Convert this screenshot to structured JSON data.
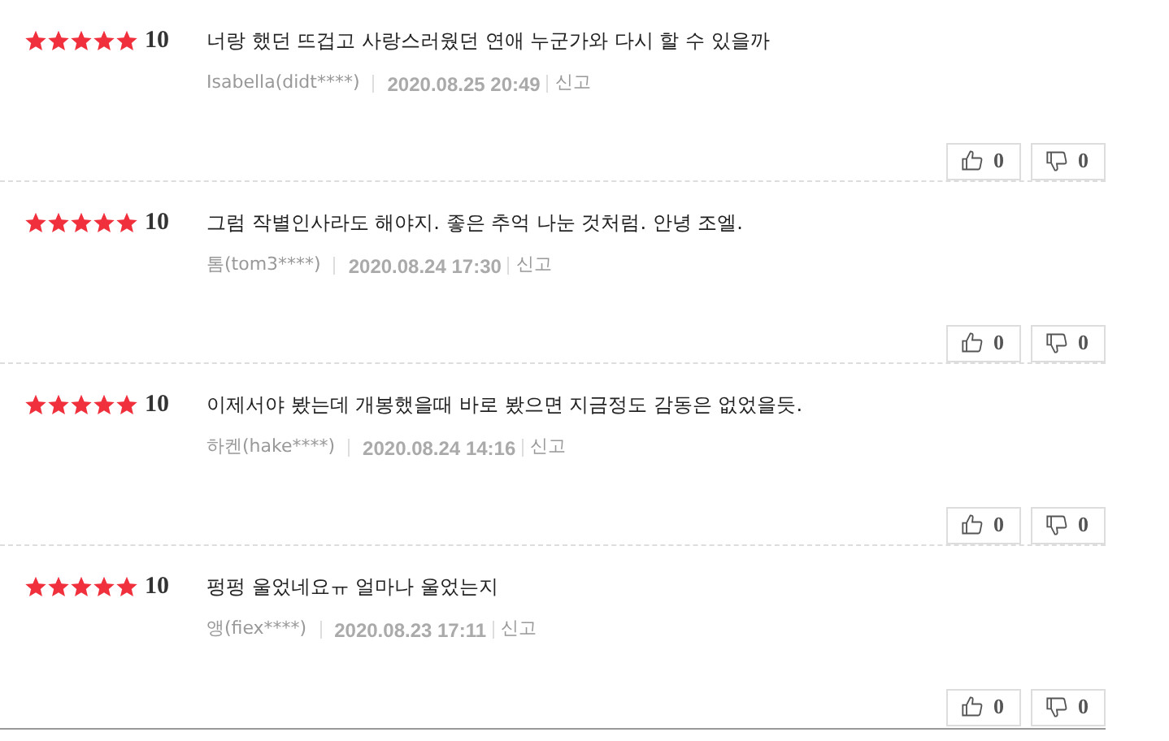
{
  "reviews": [
    {
      "stars": 5,
      "score": "10",
      "text": "너랑 했던 뜨겁고 사랑스러웠던 연애 누군가와 다시 할 수 있을까",
      "author": "Isabella(didt****)",
      "date": "2020.08.25 20:49",
      "report": "신고",
      "likes": "0",
      "dislikes": "0"
    },
    {
      "stars": 5,
      "score": "10",
      "text": "그럼 작별인사라도 해야지. 좋은 추억 나눈 것처럼. 안녕 조엘.",
      "author": "톰(tom3****)",
      "date": "2020.08.24 17:30",
      "report": "신고",
      "likes": "0",
      "dislikes": "0"
    },
    {
      "stars": 5,
      "score": "10",
      "text": "이제서야 봤는데 개봉했을때 바로 봤으면 지금정도 감동은 없었을듯.",
      "author": "하켄(hake****)",
      "date": "2020.08.24 14:16",
      "report": "신고",
      "likes": "0",
      "dislikes": "0"
    },
    {
      "stars": 5,
      "score": "10",
      "text": "펑펑 울었네요ㅠ 얼마나 울었는지",
      "author": "앵(fiex****)",
      "date": "2020.08.23 17:11",
      "report": "신고",
      "likes": "0",
      "dislikes": "0"
    }
  ]
}
